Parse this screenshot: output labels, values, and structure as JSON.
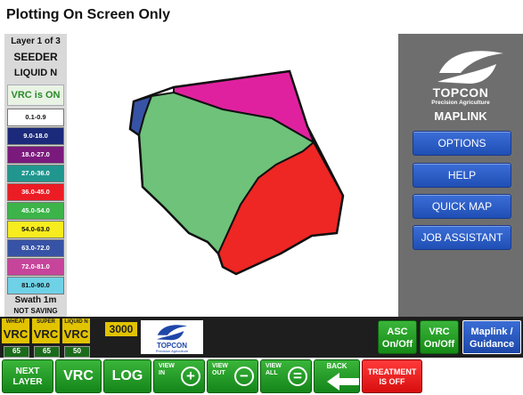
{
  "title": "Plotting On Screen Only",
  "left_panel": {
    "layer": "Layer 1 of 3",
    "implement": "SEEDER",
    "product": "LIQUID N",
    "vrc_status": "VRC is ON",
    "swath": "Swath 1m",
    "saving": "NOT SAVING"
  },
  "legend": [
    {
      "label": "0.1-0.9",
      "color": "#ffffff",
      "text_color": "#111111"
    },
    {
      "label": "9.0-18.0",
      "color": "#1b2a7a",
      "text_color": "#ffffff"
    },
    {
      "label": "18.0-27.0",
      "color": "#7b1a7d",
      "text_color": "#ffffff"
    },
    {
      "label": "27.0-36.0",
      "color": "#20968f",
      "text_color": "#ffffff"
    },
    {
      "label": "36.0-45.0",
      "color": "#ec1c24",
      "text_color": "#ffffff"
    },
    {
      "label": "45.0-54.0",
      "color": "#3cb449",
      "text_color": "#ffffff"
    },
    {
      "label": "54.0-63.0",
      "color": "#f6ec1e",
      "text_color": "#111111"
    },
    {
      "label": "63.0-72.0",
      "color": "#3753a5",
      "text_color": "#ffffff"
    },
    {
      "label": "72.0-81.0",
      "color": "#c6459b",
      "text_color": "#ffffff"
    },
    {
      "label": "81.0-90.0",
      "color": "#6fd1e6",
      "text_color": "#111111"
    }
  ],
  "map": {
    "zones": [
      {
        "name": "magenta",
        "color": "#e0219f"
      },
      {
        "name": "green",
        "color": "#6ec27a"
      },
      {
        "name": "red",
        "color": "#ee2624"
      },
      {
        "name": "blue",
        "color": "#3753a5"
      }
    ]
  },
  "brand": {
    "name": "TOPCON",
    "sub": "Precision Agriculture",
    "product": "MAPLINK",
    "color": "#ffffff"
  },
  "menu_buttons": [
    "OPTIONS",
    "HELP",
    "QUICK MAP",
    "JOB ASSISTANT"
  ],
  "products": [
    {
      "name": "WHEAT",
      "label": "VRC",
      "value": "65"
    },
    {
      "name": "SUPER",
      "label": "VRC",
      "value": "65"
    },
    {
      "name": "LIQUID N",
      "label": "VRC",
      "value": "50"
    }
  ],
  "count": "3000",
  "mini_logo": {
    "name": "TOPCON",
    "sub": "Precision Agriculture"
  },
  "status_buttons": {
    "asc": [
      "ASC",
      "On/Off"
    ],
    "vrc": [
      "VRC",
      "On/Off"
    ],
    "guidance": [
      "Maplink /",
      "Guidance"
    ]
  },
  "toolbar": {
    "next_layer": [
      "NEXT",
      "LAYER"
    ],
    "vrc": "VRC",
    "log": "LOG",
    "view_in": [
      "VIEW",
      "IN"
    ],
    "view_out": [
      "VIEW",
      "OUT"
    ],
    "view_all": [
      "VIEW",
      "ALL"
    ],
    "back": "BACK",
    "treatment": [
      "TREATMENT",
      "IS OFF"
    ]
  },
  "colors": {
    "accent_green": "#1f9a1f",
    "accent_blue": "#2557c0",
    "treatment_red": "#e01818",
    "product_yellow": "#e2c300"
  }
}
